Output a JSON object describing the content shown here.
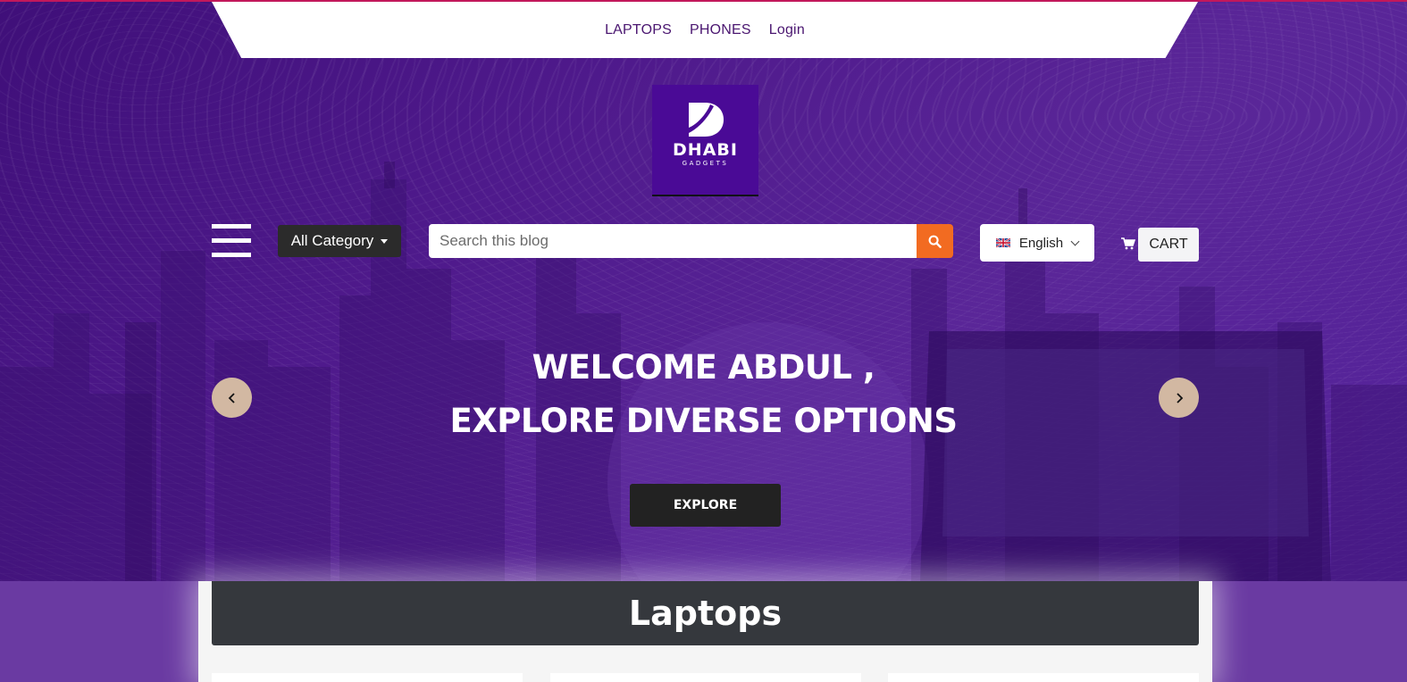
{
  "topnav": {
    "links": [
      "LAPTOPS",
      "PHONES",
      "Login"
    ]
  },
  "logo": {
    "name": "DHABI",
    "sub": "GADGETS"
  },
  "controls": {
    "category_label": "All Category",
    "search_placeholder": "Search this blog",
    "language": "English",
    "cart_label": "CART"
  },
  "hero": {
    "line1": "WELCOME ABDUL ,",
    "line2": "EXPLORE DIVERSE OPTIONS",
    "explore_label": "EXPLORE"
  },
  "section": {
    "title": "Laptops"
  },
  "icons": {
    "menu": "hamburger-menu-icon",
    "search": "search-icon",
    "flag": "uk-flag-icon",
    "cart": "cart-icon",
    "prev": "chevron-left-icon",
    "next": "chevron-right-icon"
  },
  "colors": {
    "brand_purple": "#4a0a96",
    "search_button": "#f26b21",
    "nav_text": "#4a1670",
    "arrow_bg": "#d2b8a2",
    "section_header": "#35383d"
  }
}
